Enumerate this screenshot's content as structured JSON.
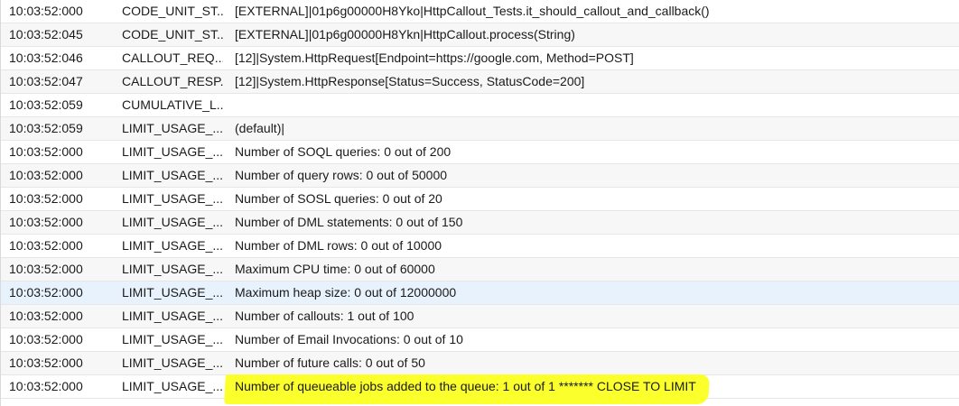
{
  "log": {
    "rows": [
      {
        "time": "10:03:52:000",
        "event": "CODE_UNIT_ST...",
        "details": "[EXTERNAL]|01p6g00000H8Yko|HttpCallout_Tests.it_should_callout_and_callback()"
      },
      {
        "time": "10:03:52:045",
        "event": "CODE_UNIT_ST...",
        "details": "[EXTERNAL]|01p6g00000H8Ykn|HttpCallout.process(String)"
      },
      {
        "time": "10:03:52:046",
        "event": "CALLOUT_REQ...",
        "details": "[12]|System.HttpRequest[Endpoint=https://google.com, Method=POST]"
      },
      {
        "time": "10:03:52:047",
        "event": "CALLOUT_RESP...",
        "details": "[12]|System.HttpResponse[Status=Success, StatusCode=200]"
      },
      {
        "time": "10:03:52:059",
        "event": "CUMULATIVE_L...",
        "details": ""
      },
      {
        "time": "10:03:52:059",
        "event": "LIMIT_USAGE_...",
        "details": "(default)|"
      },
      {
        "time": "10:03:52:000",
        "event": "LIMIT_USAGE_...",
        "details": "Number of SOQL queries: 0 out of 200"
      },
      {
        "time": "10:03:52:000",
        "event": "LIMIT_USAGE_...",
        "details": "Number of query rows: 0 out of 50000"
      },
      {
        "time": "10:03:52:000",
        "event": "LIMIT_USAGE_...",
        "details": "Number of SOSL queries: 0 out of 20"
      },
      {
        "time": "10:03:52:000",
        "event": "LIMIT_USAGE_...",
        "details": "Number of DML statements: 0 out of 150"
      },
      {
        "time": "10:03:52:000",
        "event": "LIMIT_USAGE_...",
        "details": "Number of DML rows: 0 out of 10000"
      },
      {
        "time": "10:03:52:000",
        "event": "LIMIT_USAGE_...",
        "details": "Maximum CPU time: 0 out of 60000"
      },
      {
        "time": "10:03:52:000",
        "event": "LIMIT_USAGE_...",
        "details": "Maximum heap size: 0 out of 12000000"
      },
      {
        "time": "10:03:52:000",
        "event": "LIMIT_USAGE_...",
        "details": "Number of callouts: 1 out of 100"
      },
      {
        "time": "10:03:52:000",
        "event": "LIMIT_USAGE_...",
        "details": "Number of Email Invocations: 0 out of 10"
      },
      {
        "time": "10:03:52:000",
        "event": "LIMIT_USAGE_...",
        "details": "Number of future calls: 0 out of 50"
      },
      {
        "time": "10:03:52:000",
        "event": "LIMIT_USAGE_...",
        "details": "Number of queueable jobs added to the queue: 1 out of 1 ******* CLOSE TO LIMIT"
      }
    ],
    "selected_row_index": 12,
    "highlighted_row_index": 16
  },
  "colors": {
    "selected_row": "#e8f2fc",
    "highlight_marker": "#fbff2c"
  }
}
